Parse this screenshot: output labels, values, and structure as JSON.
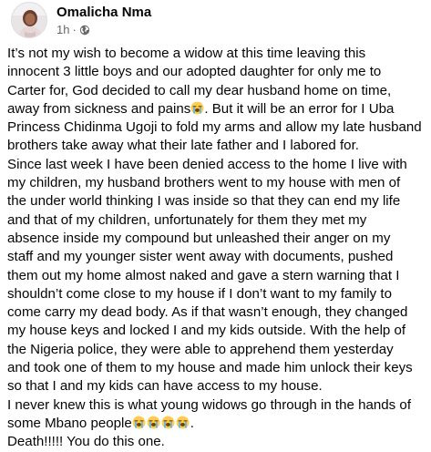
{
  "post": {
    "author": "Omalicha Nma",
    "time": "1h",
    "separator": "·",
    "privacy_icon": "globe-icon",
    "lines": [
      "It’s not my wish to become a widow at this time leaving this",
      "innocent 3 little boys and our adopted daughter for only me to",
      "Carter for, God decided to call my dear husband home on time,",
      "away from  sickness and pains",
      ". But it will be an error for I Uba",
      "Princess Chidinma Ugoji to fold my arms and allow my late husband",
      "brothers take away what their late father and I labored for.",
      "Since last week I have been denied access to the home I live with",
      "my children, my husband brothers went to my house with men of",
      "the under world thinking I was inside so that they can end my life",
      "and that of my children, unfortunately for them they met my",
      "absence inside my compound but unleashed their anger on my",
      "staff and my younger sister went away with documents, pushed",
      "them out my home almost naked and gave a stern warning that I",
      "shouldn’t come close to my house if I don’t want to my family to",
      "come carry my dead body. As if that wasn’t enough, they changed",
      "my house keys and locked I and my kids outside. With the help of",
      "the Nigeria police, they were able to apprehend them yesterday",
      "and took one of them to my house and made him unlock their keys",
      "so that I and my kids can have access to my house.",
      "I never knew this is what young widows go through in the hands of",
      "some Mbano people",
      ".",
      "Death!!!!! You do this one."
    ],
    "emoji_name": "loudly-crying-face-icon"
  },
  "colors": {
    "text": "#050505",
    "secondary": "#65676b",
    "emoji_face": "#ffcc4d",
    "emoji_tears": "#5dadec"
  }
}
